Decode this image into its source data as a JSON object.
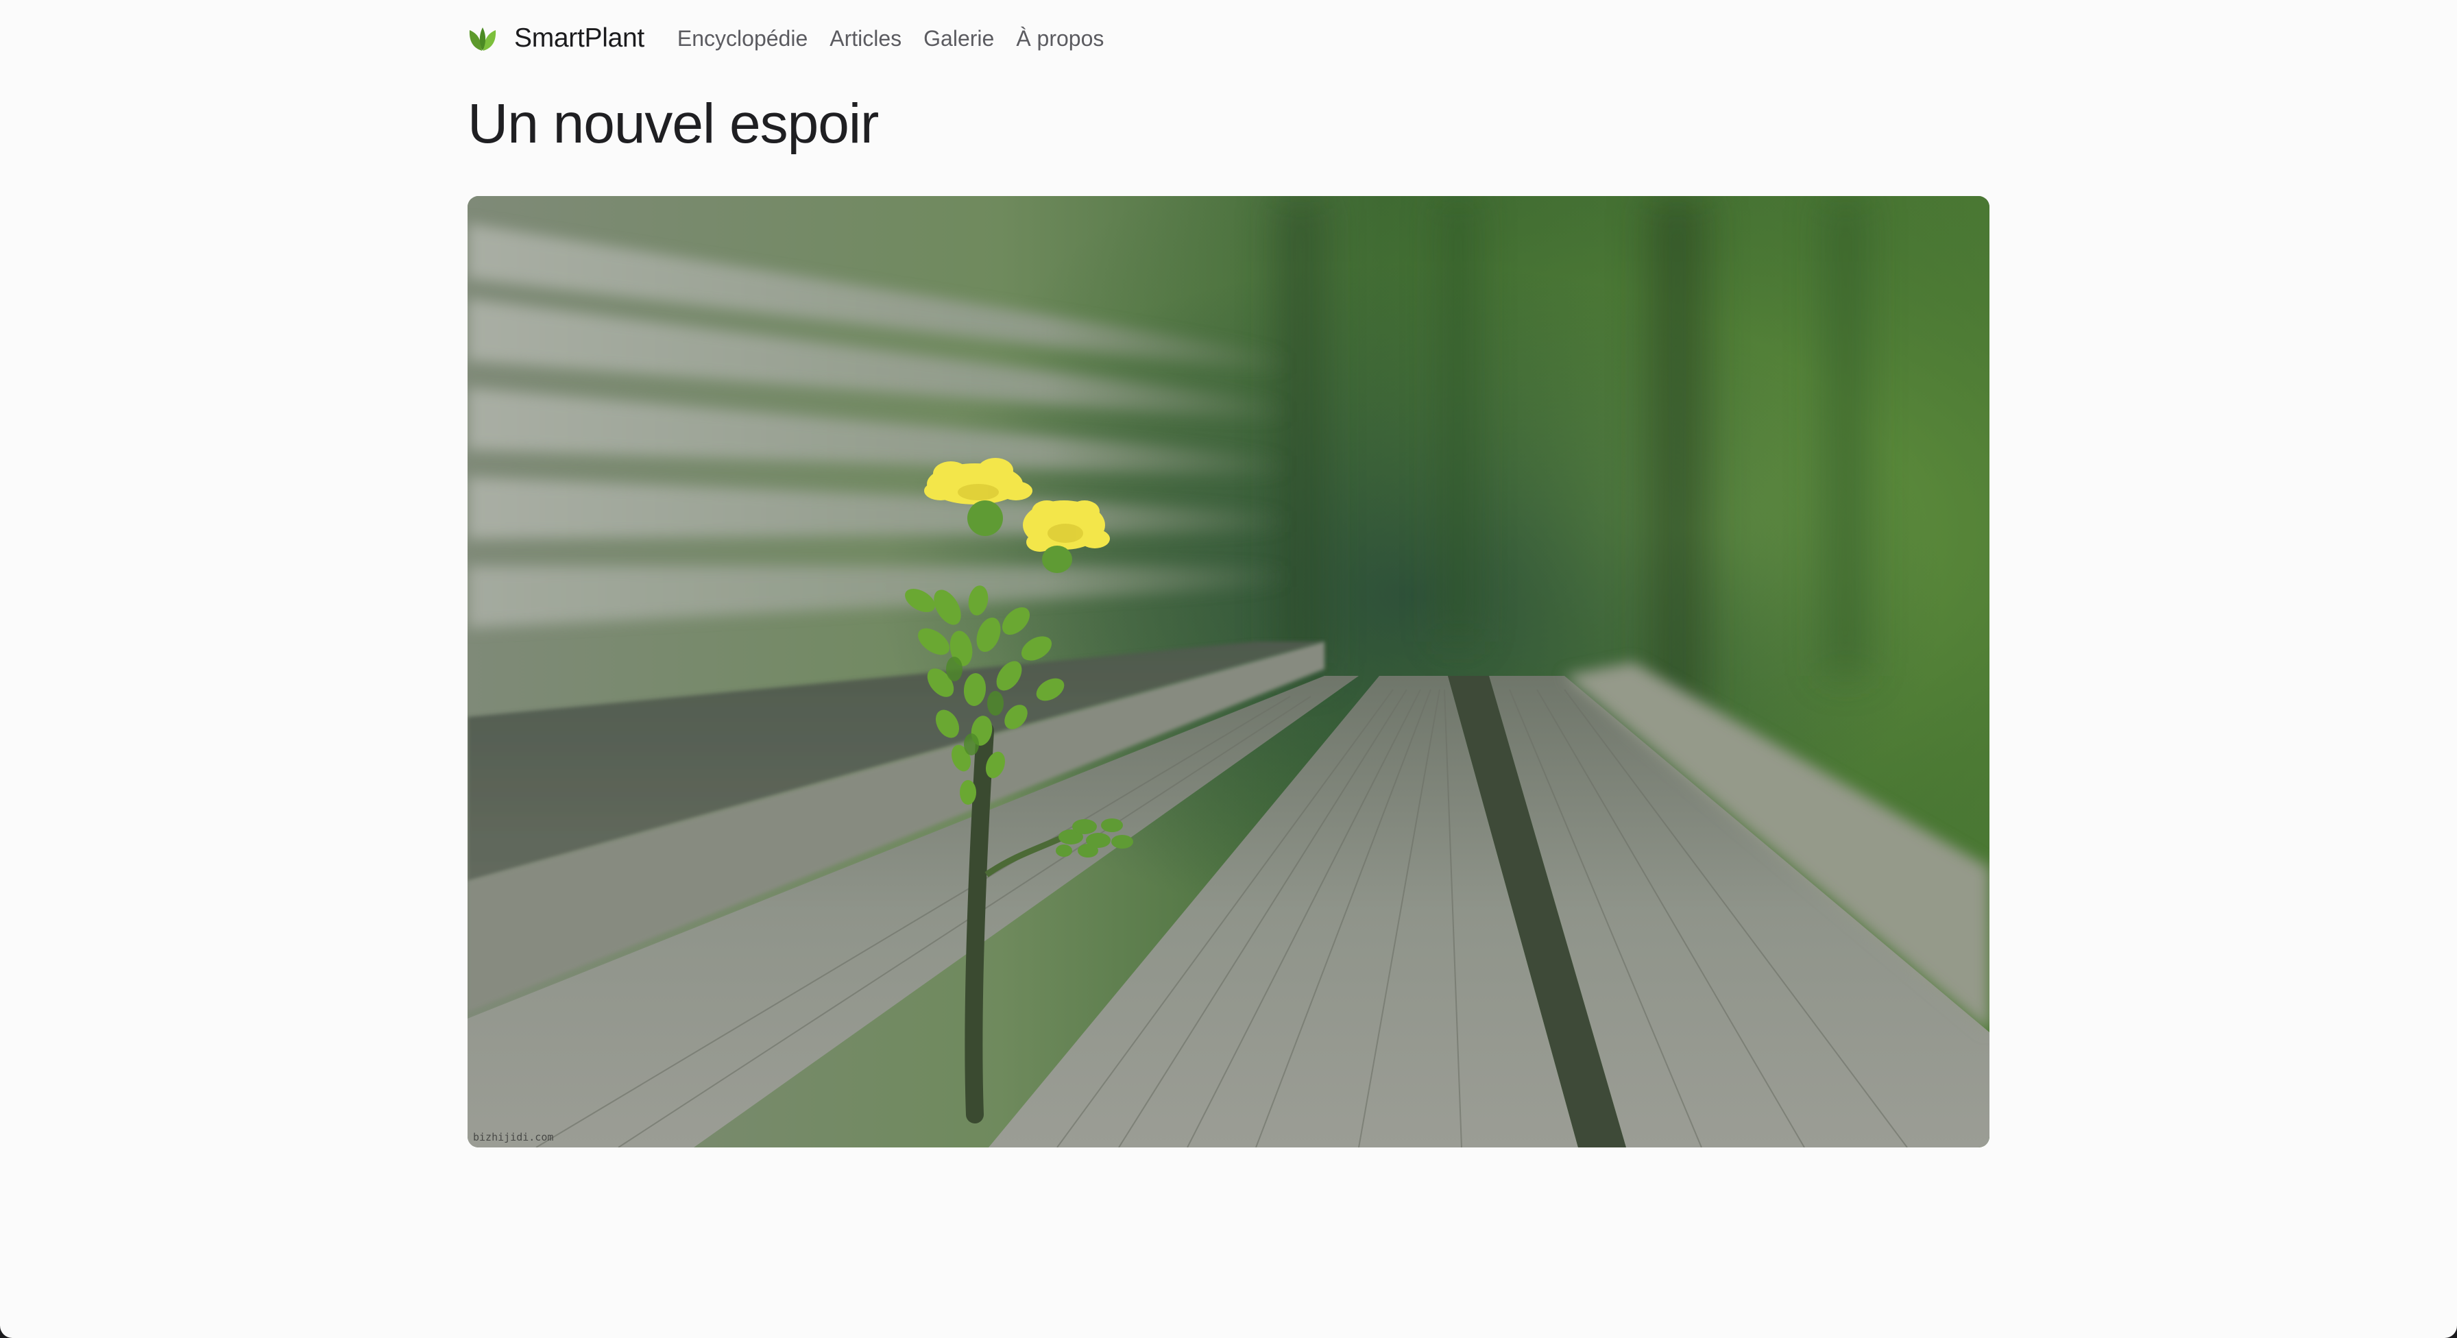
{
  "site": {
    "brand": "SmartPlant",
    "logo_icon": "leaf-icon",
    "accent_color": "#6aa832"
  },
  "nav": {
    "links": [
      {
        "label": "Encyclopédie"
      },
      {
        "label": "Articles"
      },
      {
        "label": "Galerie"
      },
      {
        "label": "À propos"
      }
    ]
  },
  "page": {
    "title": "Un nouvel espoir"
  },
  "hero_image": {
    "subject": "yellow-flower-growing-between-bench-planks",
    "watermark": "bizhijidi.com"
  }
}
